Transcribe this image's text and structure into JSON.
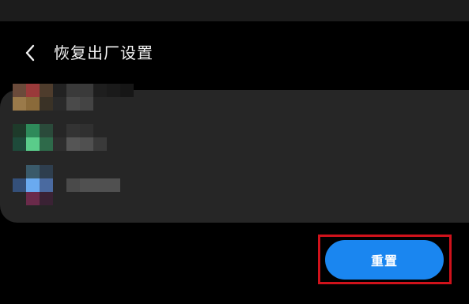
{
  "header": {
    "title": "恢复出厂设置",
    "back_icon": "chevron-left-icon"
  },
  "actions": {
    "reset_label": "重置",
    "reset_color": "#1a86f0",
    "highlight_color": "#d0121b"
  },
  "theme": {
    "background": "#000000",
    "card": "#262626",
    "top_strip": "#1c1c1c"
  },
  "blurred_rows": [
    {
      "colors": [
        "#6a4a3a",
        "#9a3a3a",
        "#4e3c2c",
        "#222222",
        "#3a3a3a",
        "#3a3a3a",
        "#1e1e1e",
        "#1a1a1a",
        "#161616",
        "#9a7a4a",
        "#8a6a3a",
        "#3a3226",
        "#2a2a2a",
        "#4a4a4a",
        "#444444",
        "#262626",
        "#262626",
        "#262626"
      ]
    },
    {
      "colors": [
        "#1e3a2a",
        "#2e8a5a",
        "#2a4a3a",
        "#262626",
        "#333333",
        "#303030",
        "#262626",
        "#1e4a3a",
        "#5acc8a",
        "#2e6a4a",
        "#2e2e2e",
        "#555555",
        "#505050",
        "#3a3a3a"
      ]
    },
    {
      "colors": [
        "#262626",
        "#3a5a6a",
        "#2e3e4e",
        "#262626",
        "#262626",
        "#262626",
        "#262626",
        "#262626",
        "#34507a",
        "#6aaaf0",
        "#4a6aa0",
        "#262626",
        "#4a4a4a",
        "#505050",
        "#505050",
        "#505050",
        "#262626",
        "#6a2a4a",
        "#3a2234",
        "#262626",
        "#262626",
        "#262626",
        "#262626",
        "#262626"
      ]
    }
  ]
}
